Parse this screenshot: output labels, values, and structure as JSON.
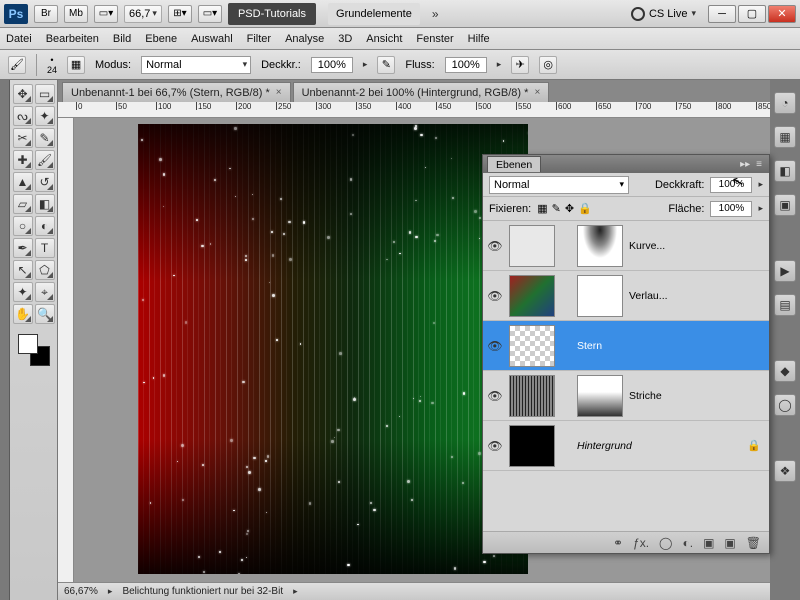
{
  "chrome": {
    "ps": "Ps",
    "br": "Br",
    "mb": "Mb",
    "zoom": "66,7",
    "workspace_btn": "PSD-Tutorials",
    "workspace_lbl": "Grundelemente",
    "cslive": "CS Live"
  },
  "menu": [
    "Datei",
    "Bearbeiten",
    "Bild",
    "Ebene",
    "Auswahl",
    "Filter",
    "Analyse",
    "3D",
    "Ansicht",
    "Fenster",
    "Hilfe"
  ],
  "options": {
    "brush_size": "24",
    "mode_label": "Modus:",
    "mode_value": "Normal",
    "opacity_label": "Deckkr.:",
    "opacity_value": "100%",
    "flow_label": "Fluss:",
    "flow_value": "100%"
  },
  "tabs": [
    "Unbenannt-1 bei 66,7% (Stern, RGB/8) *",
    "Unbenannt-2 bei 100% (Hintergrund, RGB/8) *"
  ],
  "ruler_ticks": [
    0,
    50,
    100,
    150,
    200,
    250,
    300,
    350,
    400,
    450,
    500,
    550,
    600,
    650,
    700,
    750,
    800,
    850
  ],
  "status": {
    "zoom": "66,67%",
    "msg": "Belichtung funktioniert nur bei 32-Bit"
  },
  "layers_panel": {
    "tab": "Ebenen",
    "blend_value": "Normal",
    "opacity_label": "Deckkraft:",
    "opacity_value": "100%",
    "lock_label": "Fixieren:",
    "fill_label": "Fläche:",
    "fill_value": "100%",
    "layers": [
      {
        "name": "Kurve...",
        "italic": false,
        "thumb": "t-curves",
        "mask": "t-mask-top",
        "selected": false,
        "locked": false
      },
      {
        "name": "Verlau...",
        "italic": false,
        "thumb": "t-grad",
        "mask": "white",
        "selected": false,
        "locked": false
      },
      {
        "name": "Stern",
        "italic": false,
        "thumb": "t-checker",
        "mask": null,
        "selected": true,
        "locked": false
      },
      {
        "name": "Striche",
        "italic": false,
        "thumb": "t-striche",
        "mask": "t-mask-striche",
        "selected": false,
        "locked": false
      },
      {
        "name": "Hintergrund",
        "italic": true,
        "thumb": "t-black",
        "mask": null,
        "selected": false,
        "locked": true
      }
    ]
  },
  "colors": {
    "selection": "#3a8ee6"
  }
}
